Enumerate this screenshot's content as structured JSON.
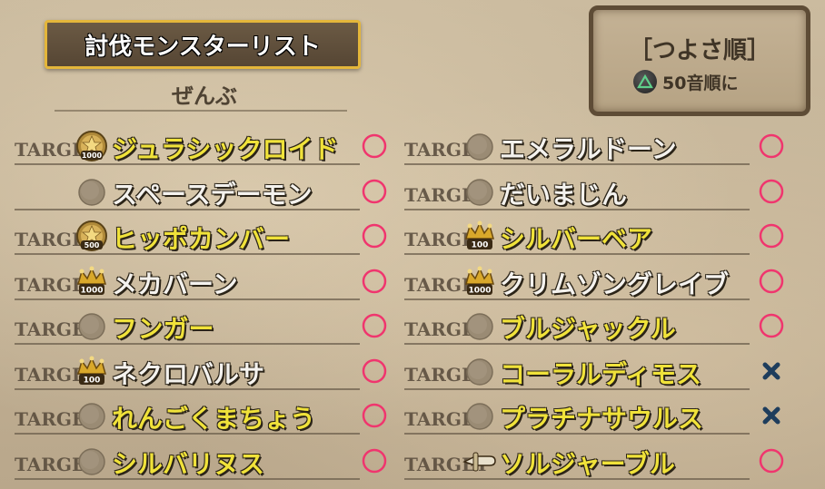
{
  "header": {
    "title": "討伐モンスターリスト",
    "subtitle": "ぜんぶ"
  },
  "sort_panel": {
    "label": "［つよさ順］",
    "hint": "50音順に",
    "button_icon": "triangle-button-icon"
  },
  "target_word": "TARGET",
  "colors": {
    "title_border": "#e4b63a",
    "name_yellow": "#f0e23a",
    "name_white": "#f4f2ee",
    "status_circle": "#f0356e",
    "status_cross": "#1e3d5c"
  },
  "left_column": [
    {
      "name": "ジュラシックロイド",
      "name_color": "yellow",
      "badge": "coin-1000",
      "badge_text": "1000",
      "status": "circle"
    },
    {
      "name": "スペースデーモン",
      "name_color": "white",
      "badge": "gray-disc",
      "badge_text": "",
      "status": "circle",
      "target_hidden": true
    },
    {
      "name": "ヒッポカンバー",
      "name_color": "yellow",
      "badge": "coin-500",
      "badge_text": "500",
      "status": "circle"
    },
    {
      "name": "メカバーン",
      "name_color": "white",
      "badge": "crown-1000",
      "badge_text": "1000",
      "status": "circle"
    },
    {
      "name": "フンガー",
      "name_color": "yellow",
      "badge": "gray-disc",
      "badge_text": "",
      "status": "circle"
    },
    {
      "name": "ネクロバルサ",
      "name_color": "white",
      "badge": "crown-100",
      "badge_text": "100",
      "status": "circle"
    },
    {
      "name": "れんごくまちょう",
      "name_color": "yellow",
      "badge": "gray-disc",
      "badge_text": "",
      "status": "circle"
    },
    {
      "name": "シルバリヌス",
      "name_color": "yellow",
      "badge": "gray-disc",
      "badge_text": "",
      "status": "circle"
    }
  ],
  "right_column": [
    {
      "name": "エメラルドーン",
      "name_color": "white",
      "badge": "gray-disc",
      "badge_text": "",
      "status": "circle"
    },
    {
      "name": "だいまじん",
      "name_color": "white",
      "badge": "gray-disc",
      "badge_text": "",
      "status": "circle"
    },
    {
      "name": "シルバーベア",
      "name_color": "yellow",
      "badge": "crown-100",
      "badge_text": "100",
      "status": "circle"
    },
    {
      "name": "クリムゾングレイブ",
      "name_color": "white",
      "badge": "crown-1000",
      "badge_text": "1000",
      "status": "circle"
    },
    {
      "name": "ブルジャックル",
      "name_color": "yellow",
      "badge": "gray-disc",
      "badge_text": "",
      "status": "circle"
    },
    {
      "name": "コーラルディモス",
      "name_color": "yellow",
      "badge": "gray-disc",
      "badge_text": "",
      "status": "cross"
    },
    {
      "name": "プラチナサウルス",
      "name_color": "yellow",
      "badge": "gray-disc",
      "badge_text": "",
      "status": "cross"
    },
    {
      "name": "ソルジャーブル",
      "name_color": "yellow",
      "badge": "pointer-hand",
      "badge_text": "",
      "status": "circle"
    }
  ]
}
